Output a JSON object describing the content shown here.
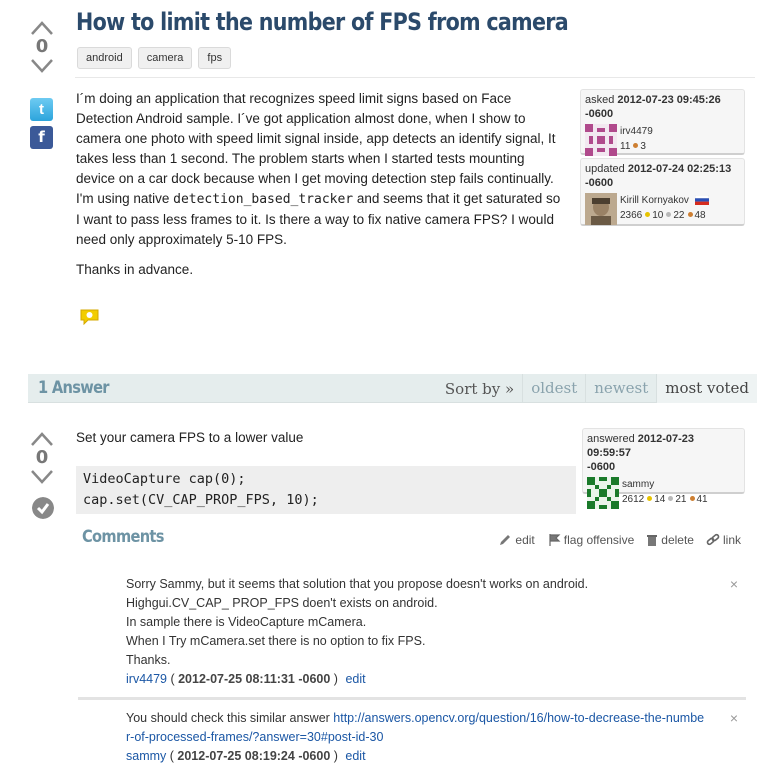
{
  "question": {
    "title": "How to limit the number of FPS from camera",
    "votes": "0",
    "tags": [
      "android",
      "camera",
      "fps"
    ],
    "body_p1_a": "I´m doing an application that recognizes speed limit signs based on Face Detection Android sample. I´ve got application almost done, when I show to camera one photo with speed limit signal inside, app detects an identify signal, It takes less than 1 second. The problem starts when I started tests mounting device on a car dock because when I get moving detection step fails continually. I'm using native ",
    "body_p1_code": "detection_based_tracker",
    "body_p1_b": " and seems that it get saturated so I want to pass less frames to it. Is there a way to fix native camera FPS? I would need only approximately 5-10 FPS.",
    "body_p2": "Thanks in advance.",
    "asked": {
      "label": "asked",
      "date": "2012-07-23 09:45:26",
      "tz": "-0600",
      "user": "irv4479",
      "karma": "11",
      "bronze": "3"
    },
    "updated": {
      "label": "updated",
      "date": "2012-07-24 02:25:13",
      "tz": "-0600",
      "user": "Kirill Kornyakov",
      "karma": "2366",
      "gold": "10",
      "silver": "22",
      "bronze": "48"
    }
  },
  "share": {
    "twitter": "t",
    "facebook": "f"
  },
  "answers_header": {
    "count_label": "1 Answer",
    "sort_label": "Sort by »",
    "sort_options": [
      "oldest",
      "newest",
      "most voted"
    ]
  },
  "answer": {
    "votes": "0",
    "body": "Set your camera FPS to a lower value",
    "code": "VideoCapture cap(0);\ncap.set(CV_CAP_PROP_FPS, 10);",
    "answered": {
      "label": "answered",
      "date": "2012-07-23 09:59:57",
      "tz": "-0600",
      "user": "sammy",
      "karma": "2612",
      "gold": "14",
      "silver": "21",
      "bronze": "41"
    },
    "actions": [
      "edit",
      "flag offensive",
      "delete",
      "link"
    ]
  },
  "comments": {
    "title": "Comments",
    "items": [
      {
        "lines": [
          "Sorry Sammy, but it seems that solution that you propose doesn't works on android.",
          "Highgui.CV_CAP_ PROP_FPS doen't exists on android.",
          "In sample there is VideoCapture mCamera.",
          "When I Try mCamera.set there is no option to fix FPS.",
          "Thanks."
        ],
        "author": "irv4479",
        "date": "2012-07-25 08:11:31 -0600",
        "edit": "edit",
        "close": "×"
      },
      {
        "text_before": "You should check this similar answer ",
        "link": "http://answers.opencv.org/question/16/how-to-decrease-the-number-of-processed-frames/?answer=30#post-id-30",
        "author": "sammy",
        "date": "2012-07-25 08:19:24 -0600",
        "edit": "edit",
        "close": "×"
      }
    ]
  },
  "colors": {
    "title": "#2b4a6b",
    "section_heading": "#6d93a4",
    "link": "#1b57a5",
    "bar_bg": "#e5eded"
  }
}
